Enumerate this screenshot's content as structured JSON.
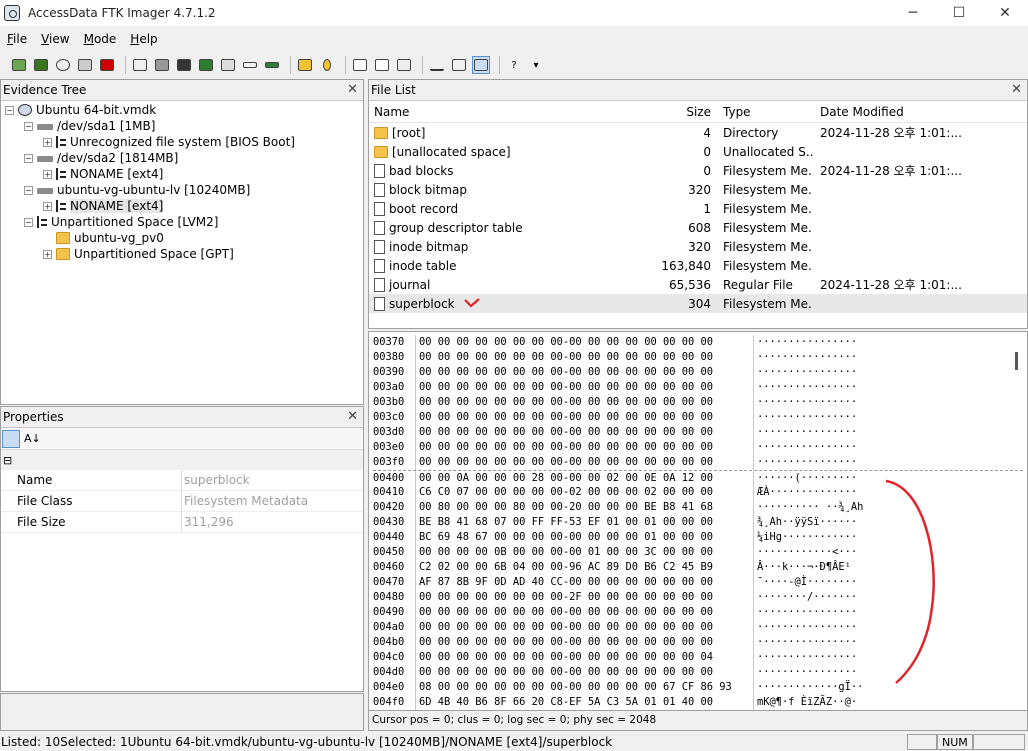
{
  "window": {
    "title": "AccessData FTK Imager 4.7.1.2"
  },
  "menu": [
    "File",
    "View",
    "Mode",
    "Help"
  ],
  "evidence_tree": {
    "title": "Evidence Tree",
    "items": [
      {
        "label": "Ubuntu 64-bit.vmdk",
        "level": 0,
        "exp": "⊟",
        "icon": "image-icon"
      },
      {
        "label": "/dev/sda1 [1MB]",
        "level": 1,
        "exp": "⊟",
        "icon": "disk-icon"
      },
      {
        "label": "Unrecognized file system [BIOS Boot]",
        "level": 2,
        "exp": "⊞",
        "icon": "filesystem-icon"
      },
      {
        "label": "/dev/sda2 [1814MB]",
        "level": 1,
        "exp": "⊟",
        "icon": "disk-icon"
      },
      {
        "label": "NONAME [ext4]",
        "level": 2,
        "exp": "⊞",
        "icon": "filesystem-icon"
      },
      {
        "label": "ubuntu-vg-ubuntu-lv [10240MB]",
        "level": 1,
        "exp": "⊟",
        "icon": "disk-icon"
      },
      {
        "label": "NONAME [ext4]",
        "level": 2,
        "exp": "⊞",
        "icon": "filesystem-icon"
      },
      {
        "label": "Unpartitioned Space [LVM2]",
        "level": 1,
        "exp": "⊟",
        "icon": "filesystem-icon"
      },
      {
        "label": "ubuntu-vg_pv0",
        "level": 2,
        "exp": "",
        "icon": "folder-icon"
      },
      {
        "label": "Unpartitioned Space [GPT]",
        "level": 2,
        "exp": "⊞",
        "icon": "folder-icon"
      }
    ]
  },
  "file_list": {
    "title": "File List",
    "headers": {
      "name": "Name",
      "size": "Size",
      "type": "Type",
      "date": "Date Modified"
    },
    "rows": [
      {
        "name": "[root]",
        "size": "4",
        "type": "Directory",
        "date": "2024-11-28 오후 1:01:...",
        "icon": "folder-icon"
      },
      {
        "name": "[unallocated space]",
        "size": "0",
        "type": "Unallocated S...",
        "date": "",
        "icon": "folder-icon"
      },
      {
        "name": "bad blocks",
        "size": "0",
        "type": "Filesystem Me...",
        "date": "2024-11-28 오후 1:01:...",
        "icon": "file-icon"
      },
      {
        "name": "block bitmap",
        "size": "320",
        "type": "Filesystem Me...",
        "date": "",
        "icon": "file-icon"
      },
      {
        "name": "boot record",
        "size": "1",
        "type": "Filesystem Me...",
        "date": "",
        "icon": "file-icon"
      },
      {
        "name": "group descriptor table",
        "size": "608",
        "type": "Filesystem Me...",
        "date": "",
        "icon": "file-icon"
      },
      {
        "name": "inode bitmap",
        "size": "320",
        "type": "Filesystem Me...",
        "date": "",
        "icon": "file-icon"
      },
      {
        "name": "inode table",
        "size": "163,840",
        "type": "Filesystem Me...",
        "date": "",
        "icon": "file-icon"
      },
      {
        "name": "journal",
        "size": "65,536",
        "type": "Regular File",
        "date": "2024-11-28 오후 1:01:...",
        "icon": "file-icon"
      },
      {
        "name": "superblock",
        "size": "304",
        "type": "Filesystem Me...",
        "date": "",
        "icon": "file-icon",
        "selected": true
      }
    ]
  },
  "properties": {
    "title": "Properties",
    "rows": [
      {
        "key": "Name",
        "value": "superblock"
      },
      {
        "key": "File Class",
        "value": "Filesystem Metadata"
      },
      {
        "key": "File Size",
        "value": "311,296"
      }
    ]
  },
  "hex": {
    "rows": [
      {
        "addr": "00370",
        "bytes": "00 00 00 00 00 00 00 00-00 00 00 00 00 00 00 00",
        "ascii": "················"
      },
      {
        "addr": "00380",
        "bytes": "00 00 00 00 00 00 00 00-00 00 00 00 00 00 00 00",
        "ascii": "················"
      },
      {
        "addr": "00390",
        "bytes": "00 00 00 00 00 00 00 00-00 00 00 00 00 00 00 00",
        "ascii": "················"
      },
      {
        "addr": "003a0",
        "bytes": "00 00 00 00 00 00 00 00-00 00 00 00 00 00 00 00",
        "ascii": "················"
      },
      {
        "addr": "003b0",
        "bytes": "00 00 00 00 00 00 00 00-00 00 00 00 00 00 00 00",
        "ascii": "················"
      },
      {
        "addr": "003c0",
        "bytes": "00 00 00 00 00 00 00 00-00 00 00 00 00 00 00 00",
        "ascii": "················"
      },
      {
        "addr": "003d0",
        "bytes": "00 00 00 00 00 00 00 00-00 00 00 00 00 00 00 00",
        "ascii": "················"
      },
      {
        "addr": "003e0",
        "bytes": "00 00 00 00 00 00 00 00-00 00 00 00 00 00 00 00",
        "ascii": "················"
      },
      {
        "addr": "003f0",
        "bytes": "00 00 00 00 00 00 00 00-00 00 00 00 00 00 00 00",
        "ascii": "················"
      },
      {
        "addr": "00400",
        "bytes": "00 00 0A 00 00 00 28 00-00 00 02 00 0E 0A 12 00",
        "ascii": "······(·········"
      },
      {
        "addr": "00410",
        "bytes": "C6 C0 07 00 00 00 00 00-02 00 00 00 02 00 00 00",
        "ascii": "ÆÀ··············"
      },
      {
        "addr": "00420",
        "bytes": "00 80 00 00 00 80 00 00-20 00 00 00 BE B8 41 68",
        "ascii": "·········· ··¾¸Ah"
      },
      {
        "addr": "00430",
        "bytes": "BE B8 41 68 07 00 FF FF-53 EF 01 00 01 00 00 00",
        "ascii": "¾¸Ah··ÿÿSï······"
      },
      {
        "addr": "00440",
        "bytes": "BC 69 48 67 00 00 00 00-00 00 00 00 01 00 00 00",
        "ascii": "¼iHg············"
      },
      {
        "addr": "00450",
        "bytes": "00 00 00 00 0B 00 00 00-00 01 00 00 3C 00 00 00",
        "ascii": "············<···"
      },
      {
        "addr": "00460",
        "bytes": "C2 02 00 00 6B 04 00 00-96 AC 89 D0 B6 C2 45 B9",
        "ascii": "Â···k···¬·Ð¶ÂE¹"
      },
      {
        "addr": "00470",
        "bytes": "AF 87 8B 9F 0D AD 40 CC-00 00 00 00 00 00 00 00",
        "ascii": "¯····-@Ì········"
      },
      {
        "addr": "00480",
        "bytes": "00 00 00 00 00 00 00 00-2F 00 00 00 00 00 00 00",
        "ascii": "········/·······"
      },
      {
        "addr": "00490",
        "bytes": "00 00 00 00 00 00 00 00-00 00 00 00 00 00 00 00",
        "ascii": "················"
      },
      {
        "addr": "004a0",
        "bytes": "00 00 00 00 00 00 00 00-00 00 00 00 00 00 00 00",
        "ascii": "················"
      },
      {
        "addr": "004b0",
        "bytes": "00 00 00 00 00 00 00 00-00 00 00 00 00 00 00 00",
        "ascii": "················"
      },
      {
        "addr": "004c0",
        "bytes": "00 00 00 00 00 00 00 00-00 00 00 00 00 00 00 04",
        "ascii": "················"
      },
      {
        "addr": "004d0",
        "bytes": "00 00 00 00 00 00 00 00-00 00 00 00 00 00 00 00",
        "ascii": "················"
      },
      {
        "addr": "004e0",
        "bytes": "08 00 00 00 00 00 00 00-00 00 00 00 00 67 CF 86 93",
        "ascii": "·············gÏ··"
      },
      {
        "addr": "004f0",
        "bytes": "6D 4B 40 B6 8F 66 20 C8-EF 5A C3 5A 01 01 40 00",
        "ascii": "mK@¶·f ÈïZÃZ··@·"
      }
    ],
    "cursor_status": "Cursor pos = 0; clus = 0; log sec = 0; phy sec = 2048"
  },
  "status": {
    "text": "Listed: 10Selected: 1Ubuntu 64-bit.vmdk/ubuntu-vg-ubuntu-lv [10240MB]/NONAME [ext4]/superblock",
    "num": "NUM"
  },
  "annotation_color": "#e0242a"
}
